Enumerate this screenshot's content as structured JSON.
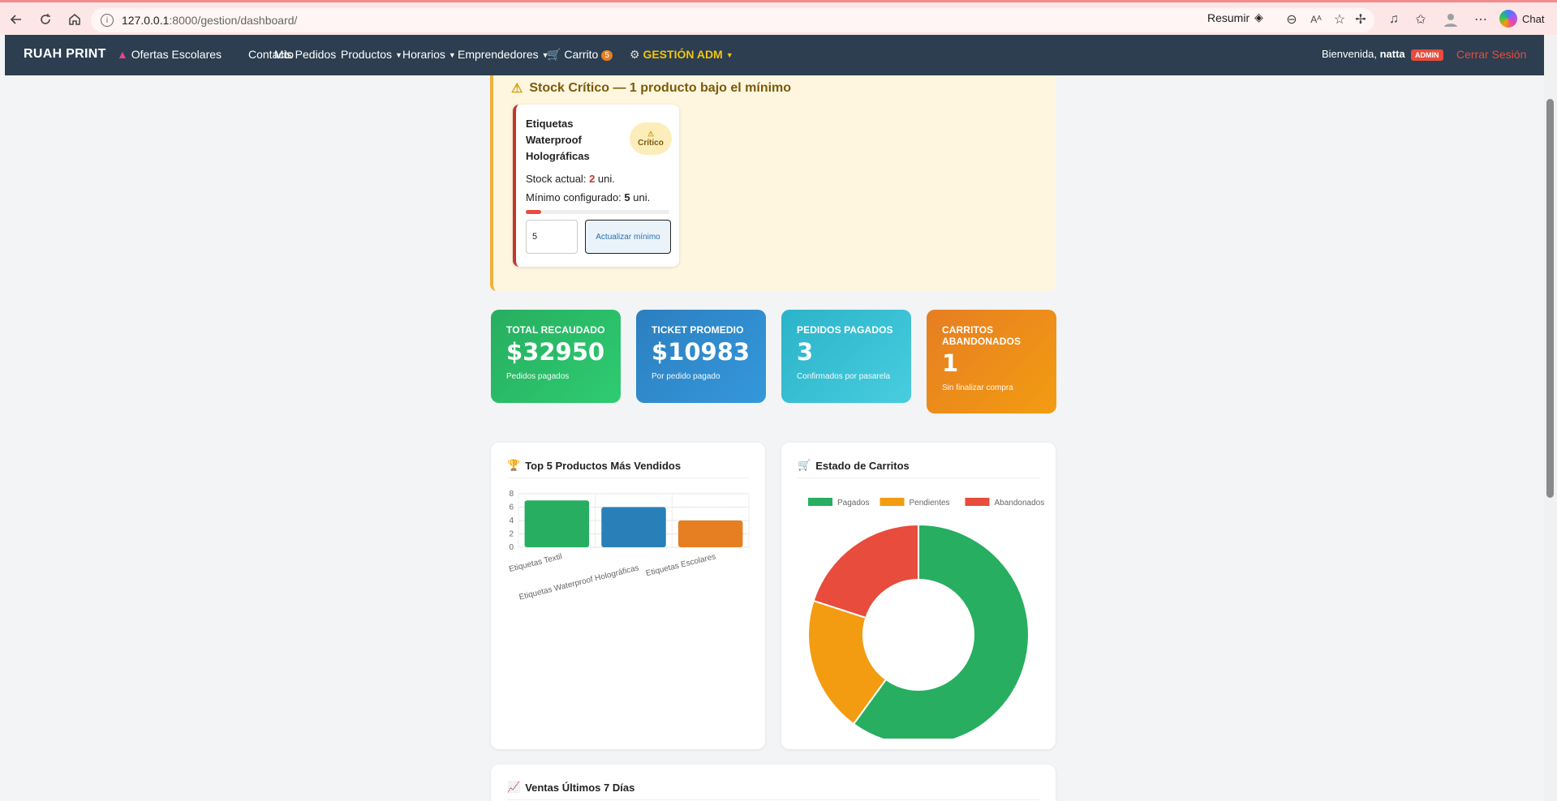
{
  "browser": {
    "url_host": "127.0.0.1",
    "url_path": ":8000/gestion/dashboard/",
    "resumir_label": "Resumir",
    "chat_label": "Chat"
  },
  "nav": {
    "brand": "RUAH PRINT",
    "ofertas": "Ofertas Escolares",
    "contacto": "Contacto",
    "pedidos": "Mis Pedidos",
    "productos": "Productos",
    "horarios": "Horarios",
    "emprendedores": "Emprendedores",
    "carrito": "Carrito",
    "carrito_count": "5",
    "admin": "GESTIÓN ADM",
    "welcome_prefix": "Bienvenida,",
    "username": "natta",
    "role": "ADMIN",
    "logout": "Cerrar Sesión"
  },
  "stock": {
    "title": "Stock Crítico — 1 producto bajo el mínimo",
    "product_name": "Etiquetas Waterproof Holográficas",
    "badge": "Crítico",
    "stock_label": "Stock actual:",
    "stock_value": "2",
    "unit": "uni.",
    "min_label": "Mínimo configurado:",
    "min_value": "5",
    "fill_fraction": 0.11,
    "input_value": "5",
    "button_label": "Actualizar mínimo"
  },
  "kpis": [
    {
      "title": "TOTAL RECAUDADO",
      "value": "$32950",
      "sub": "Pedidos pagados"
    },
    {
      "title": "TICKET PROMEDIO",
      "value": "$10983",
      "sub": "Por pedido pagado"
    },
    {
      "title": "PEDIDOS PAGADOS",
      "value": "3",
      "sub": "Confirmados por pasarela"
    },
    {
      "title": "CARRITOS ABANDONADOS",
      "value": "1",
      "sub": "Sin finalizar compra"
    }
  ],
  "panels": {
    "top_title": "Top 5 Productos Más Vendidos",
    "carts_title": "Estado de Carritos",
    "sales_title": "Ventas Últimos 7 Días"
  },
  "chart_data": [
    {
      "type": "bar",
      "title": "Top 5 Productos Más Vendidos",
      "categories": [
        "Etiquetas Textil",
        "Etiquetas Waterproof Holográficas",
        "Etiquetas Escolares"
      ],
      "values": [
        7,
        6,
        4
      ],
      "colors": [
        "#27ae60",
        "#2980b9",
        "#e67e22"
      ],
      "ylim": [
        0,
        8
      ],
      "yticks": [
        0,
        2,
        4,
        6,
        8
      ],
      "grid": true
    },
    {
      "type": "pie",
      "title": "Estado de Carritos",
      "labels": [
        "Pagados",
        "Pendientes",
        "Abandonados"
      ],
      "values": [
        3,
        1,
        1
      ],
      "colors": [
        "#27ae60",
        "#f39c12",
        "#e74c3c"
      ],
      "legend": "top"
    }
  ]
}
